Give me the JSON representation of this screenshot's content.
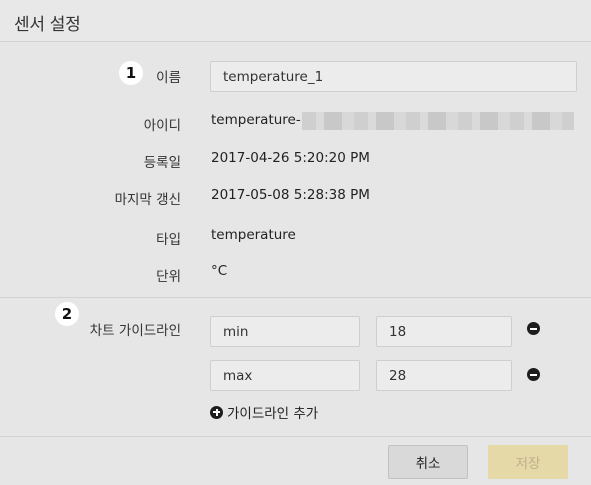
{
  "dialog": {
    "title": "센서 설정"
  },
  "badges": {
    "one": "1",
    "two": "2"
  },
  "fields": {
    "name": {
      "label": "이름",
      "value": "temperature_1"
    },
    "id": {
      "label": "아이디",
      "value": "temperature-"
    },
    "registered": {
      "label": "등록일",
      "value": "2017-04-26 5:20:20 PM"
    },
    "last_update": {
      "label": "마지막 갱신",
      "value": "2017-05-08 5:28:38 PM"
    },
    "type": {
      "label": "타입",
      "value": "temperature"
    },
    "unit": {
      "label": "단위",
      "value": "°C"
    }
  },
  "guidelines": {
    "label": "차트 가이드라인",
    "rows": [
      {
        "name": "min",
        "value": "18"
      },
      {
        "name": "max",
        "value": "28"
      }
    ],
    "add_label": "가이드라인 추가"
  },
  "buttons": {
    "cancel": "취소",
    "save": "저장"
  },
  "colors": {
    "save_disabled_bg": "#e6d9a8",
    "save_disabled_text": "#bdb08a"
  }
}
